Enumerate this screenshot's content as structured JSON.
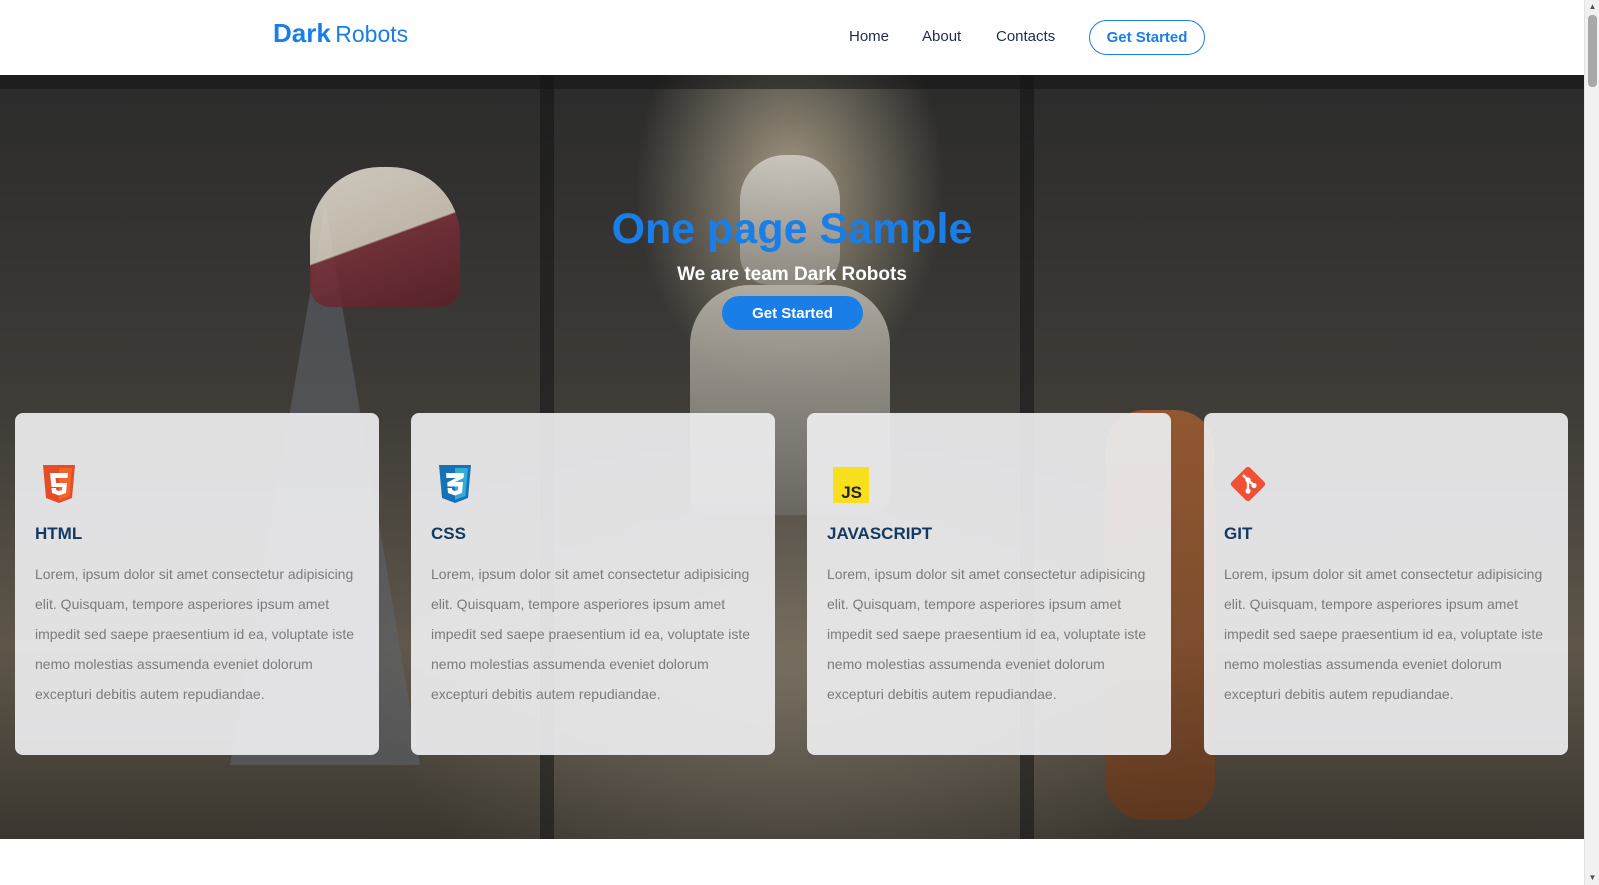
{
  "header": {
    "logo_bold": "Dark",
    "logo_light": "Robots",
    "nav": [
      "Home",
      "About",
      "Contacts"
    ],
    "cta_label": "Get Started"
  },
  "hero": {
    "title": "One page Sample",
    "subtitle": "We are team Dark Robots",
    "cta_label": "Get Started"
  },
  "cards": [
    {
      "icon": "html5-icon",
      "title": "HTML",
      "text": "Lorem, ipsum dolor sit amet consectetur adipisicing elit. Quisquam, tempore asperiores ipsum amet impedit sed saepe praesentium id ea, voluptate iste nemo molestias assumenda eveniet dolorum excepturi debitis autem repudiandae."
    },
    {
      "icon": "css3-icon",
      "title": "CSS",
      "text": "Lorem, ipsum dolor sit amet consectetur adipisicing elit. Quisquam, tempore asperiores ipsum amet impedit sed saepe praesentium id ea, voluptate iste nemo molestias assumenda eveniet dolorum excepturi debitis autem repudiandae."
    },
    {
      "icon": "javascript-icon",
      "title": "JAVASCRIPT",
      "icon_text": "JS",
      "text": "Lorem, ipsum dolor sit amet consectetur adipisicing elit. Quisquam, tempore asperiores ipsum amet impedit sed saepe praesentium id ea, voluptate iste nemo molestias assumenda eveniet dolorum excepturi debitis autem repudiandae."
    },
    {
      "icon": "git-icon",
      "title": "GIT",
      "text": "Lorem, ipsum dolor sit amet consectetur adipisicing elit. Quisquam, tempore asperiores ipsum amet impedit sed saepe praesentium id ea, voluptate iste nemo molestias assumenda eveniet dolorum excepturi debitis autem repudiandae."
    }
  ],
  "colors": {
    "accent": "#1a7ee8",
    "card_title": "#153a62",
    "html5": "#e44d26",
    "css3": "#1572b6",
    "javascript": "#f7df1e",
    "git": "#f05033"
  }
}
